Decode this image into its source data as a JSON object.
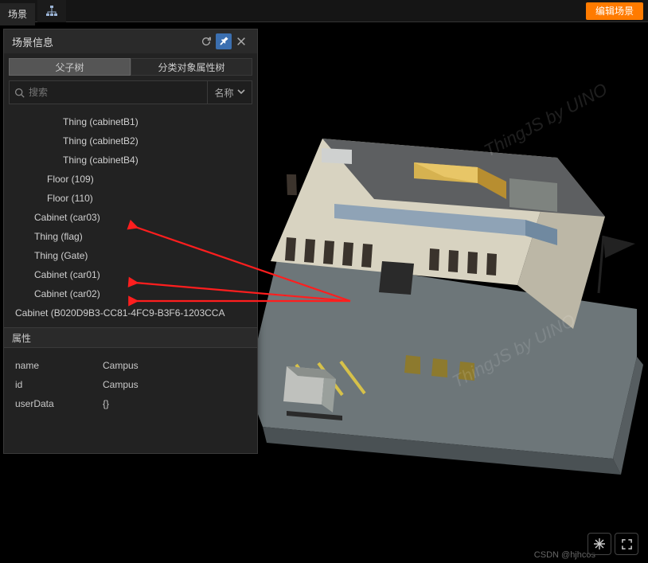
{
  "topbar": {
    "scene_tab": "场景",
    "edit_scene": "编辑场景"
  },
  "panel": {
    "title": "场景信息",
    "tabs": [
      "父子树",
      "分类对象属性树"
    ],
    "search_placeholder": "搜索",
    "search_mode": "名称",
    "props_title": "属性",
    "tree": [
      {
        "label": "Thing (cabinetB1)",
        "indent": 3
      },
      {
        "label": "Thing (cabinetB2)",
        "indent": 3
      },
      {
        "label": "Thing (cabinetB4)",
        "indent": 3
      },
      {
        "label": "Floor (109)",
        "indent": 2
      },
      {
        "label": "Floor (110)",
        "indent": 2
      },
      {
        "label": "Cabinet (car03)",
        "indent": 1
      },
      {
        "label": "Thing (flag)",
        "indent": 1
      },
      {
        "label": "Thing (Gate)",
        "indent": 1
      },
      {
        "label": "Cabinet (car01)",
        "indent": 1
      },
      {
        "label": "Cabinet (car02)",
        "indent": 1
      },
      {
        "label": "Cabinet (B020D9B3-CC81-4FC9-B3F6-1203CCA",
        "indent": 0
      }
    ],
    "props": [
      {
        "key": "name",
        "val": "Campus"
      },
      {
        "key": "id",
        "val": "Campus"
      },
      {
        "key": "userData",
        "val": "{}"
      }
    ]
  },
  "watermark": "ThingJS by UINO",
  "credit": "CSDN @hjhcos"
}
